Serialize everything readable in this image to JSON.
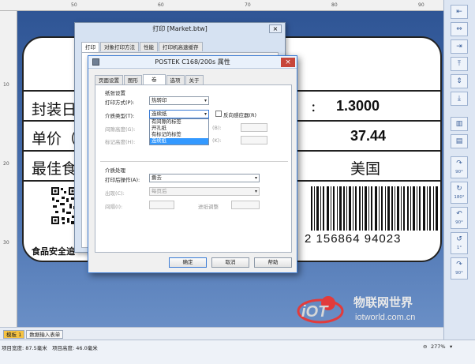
{
  "label": {
    "row1_prefix": "封装日",
    "row1_colon": "：",
    "row1_value": "1.3000",
    "row2_prefix": "单价（",
    "row2_value": "37.44",
    "row3_prefix": "最佳食",
    "row3_value": "美国",
    "footer_text": "食品安全追",
    "barcode_digits": "2 156864 94023"
  },
  "dialog_back": {
    "title": "打印 [Market.btw]",
    "tabs": [
      "打印",
      "对象打印方法",
      "性能",
      "打印机高速缓存"
    ]
  },
  "dialog_front": {
    "title": "POSTEK C168/200s 属性",
    "close": "×",
    "tabs": [
      "页面设置",
      "图形",
      "卷",
      "选项",
      "关于"
    ],
    "group_paper": "纸张设置",
    "print_method_label": "打印方式(P):",
    "print_method_value": "热转印",
    "media_type_label": "介质类型(T):",
    "media_type_value": "连续纸",
    "reverse_sensor_label": "反向感应器(R)",
    "gap_height_label": "间隙高度(G):",
    "mark_height_label": "标记高度(H):",
    "offset_label_1": "(B):",
    "offset_label_2": "(K):",
    "dropdown_options": [
      "有间隙的标签",
      "开孔纸",
      "有标记的标签",
      "连续纸"
    ],
    "group_media": "介质处理",
    "post_print_label": "打印后操作(A):",
    "post_print_value": "撕去",
    "occurrence_label": "出现(C):",
    "occurrence_value": "每页后",
    "interval_label": "间隔(I):",
    "feed_adjust_label": "进纸调整",
    "ok": "确定",
    "cancel": "取消",
    "help": "帮助"
  },
  "toolbar": {
    "rotate_labels": [
      "90°",
      "180°",
      "90°",
      "1°",
      "90°"
    ]
  },
  "sheet_tabs": [
    "模板 1",
    "数据输入表单"
  ],
  "status": {
    "width": "项目宽度: 87.5毫米",
    "height": "项目高度: 46.0毫米",
    "zoom": "277%"
  },
  "watermark": {
    "cn": "物联网世界",
    "url": "iotworld.com.cn",
    "logo": "iOT"
  },
  "ruler_top": [
    "50",
    "60",
    "70",
    "80",
    "90"
  ],
  "ruler_left": [
    "10",
    "20",
    "30"
  ],
  "colors": {
    "canvas": "#3a5f9a",
    "selected": "#3399ff",
    "active_tab": "#f6c342"
  }
}
